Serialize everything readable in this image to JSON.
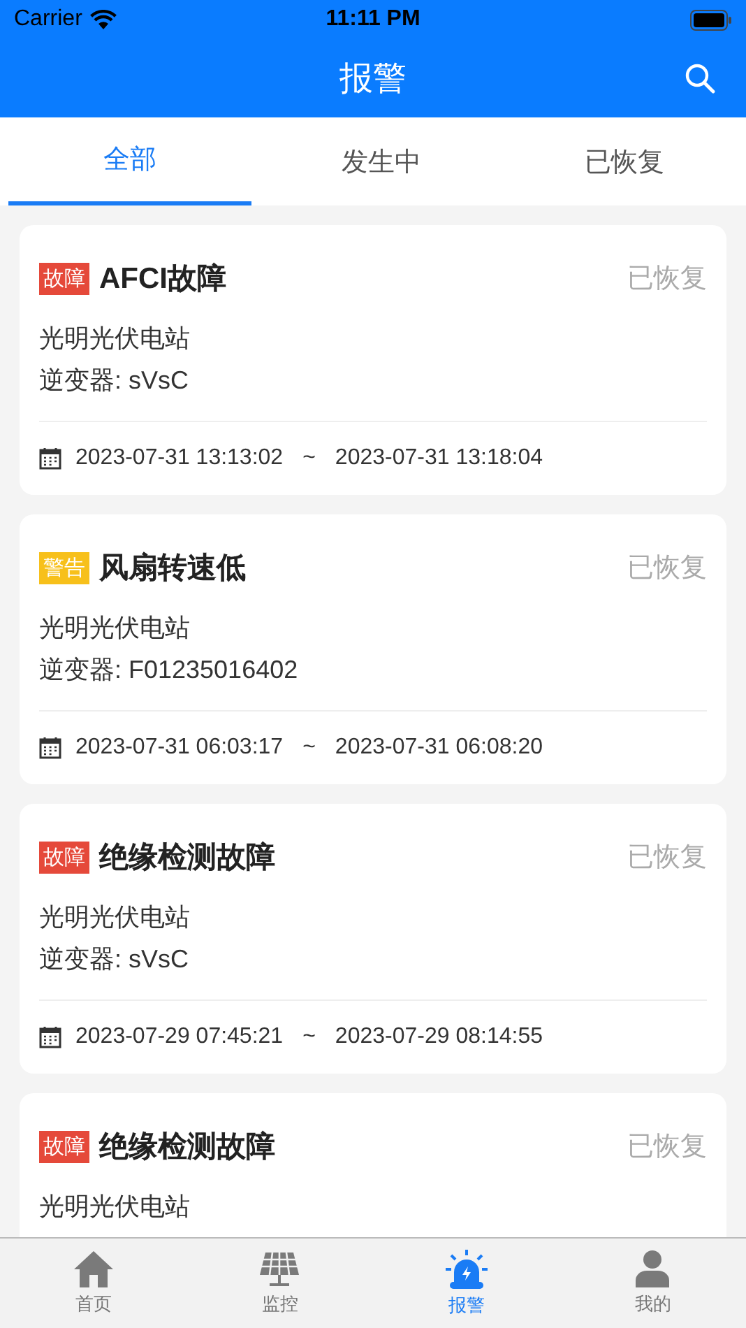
{
  "status_bar": {
    "carrier": "Carrier",
    "time": "11:11 PM"
  },
  "header": {
    "title": "报警"
  },
  "tabs": [
    {
      "label": "全部",
      "selected": true
    },
    {
      "label": "发生中",
      "selected": false
    },
    {
      "label": "已恢复",
      "selected": false
    }
  ],
  "alarms": [
    {
      "tag": "故障",
      "kind": "fault",
      "title": "AFCI故障",
      "status": "已恢复",
      "station": "光明光伏电站",
      "inverter": "逆变器: sVsC",
      "start": "2023-07-31 13:13:02",
      "separator": "~",
      "end": "2023-07-31 13:18:04"
    },
    {
      "tag": "警告",
      "kind": "warning",
      "title": "风扇转速低",
      "status": "已恢复",
      "station": "光明光伏电站",
      "inverter": "逆变器: F01235016402",
      "start": "2023-07-31 06:03:17",
      "separator": "~",
      "end": "2023-07-31 06:08:20"
    },
    {
      "tag": "故障",
      "kind": "fault",
      "title": "绝缘检测故障",
      "status": "已恢复",
      "station": "光明光伏电站",
      "inverter": "逆变器: sVsC",
      "start": "2023-07-29 07:45:21",
      "separator": "~",
      "end": "2023-07-29 08:14:55"
    },
    {
      "tag": "故障",
      "kind": "fault",
      "title": "绝缘检测故障",
      "status": "已恢复",
      "station": "光明光伏电站"
    }
  ],
  "tab_bar": [
    {
      "label": "首页",
      "kind": "home",
      "selected": false
    },
    {
      "label": "监控",
      "kind": "monitor",
      "selected": false
    },
    {
      "label": "报警",
      "kind": "alarm",
      "selected": true
    },
    {
      "label": "我的",
      "kind": "profile",
      "selected": false
    }
  ]
}
